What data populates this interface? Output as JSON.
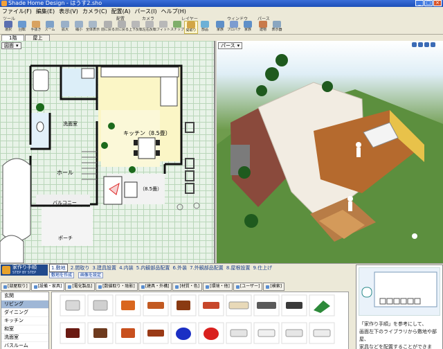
{
  "window": {
    "title": "Shade Home Design - はうす2.sho"
  },
  "menu": [
    "ファイル(F)",
    "編集(E)",
    "表示(V)",
    "カメラ(C)",
    "配置(A)",
    "パース(I)",
    "ヘルプ(H)"
  ],
  "toolbar": {
    "groups": [
      "ツール",
      "配置",
      "カメラ",
      "レイヤー",
      "ウィンドウ",
      "パース"
    ],
    "buttons": [
      "選択",
      "回転",
      "手抜き",
      "ズーム",
      "拡大",
      "縮小",
      "全体表示",
      "前に戻る",
      "次に戻る",
      "上下反転",
      "左右反転",
      "フィット",
      "スナップ",
      "間取り",
      "部品",
      "家族",
      "プロパティ",
      "家族",
      "建物",
      "表示器"
    ]
  },
  "floor_tabs": [
    "1階",
    "屋上"
  ],
  "plan": {
    "view_label": "図面",
    "rooms": {
      "kitchen": "キッチン（8.5畳）",
      "washroom": "洗面室",
      "hall": "ホール",
      "living": "（8.5畳）",
      "balcony": "バルコニー",
      "porch": "ポーチ"
    }
  },
  "scene": {
    "view_label": "パース"
  },
  "bottom": {
    "brand": {
      "title": "家作り手順",
      "subtitle": "STEP BY STEP"
    },
    "steps": [
      "1.敷地",
      "2.間取り",
      "3.建具設置",
      "4.内装",
      "5.内観部品配置",
      "6.外装",
      "7.外観部品配置",
      "8.屋根設置",
      "9.仕上げ"
    ],
    "substeps": [
      "敷地を作成",
      "画像を設定"
    ],
    "category_tabs": [
      "[部屋取り]",
      "[設備・家具]",
      "[電化製品]",
      "[数値取り・陰影]",
      "[建具・外構]",
      "[材質・色]",
      "[環境・他]",
      "[ユーザー]",
      "[検索]"
    ],
    "category_list": [
      "玄関",
      "リビング",
      "ダイニング",
      "キッチン",
      "和室",
      "洗面室",
      "バスルーム"
    ],
    "selected_category": "リビング",
    "helper_text": [
      "「家作り手順」を参考にして、",
      "画面左下のライブラリから敷地や部屋、",
      "家具などを配置することができます。"
    ]
  }
}
